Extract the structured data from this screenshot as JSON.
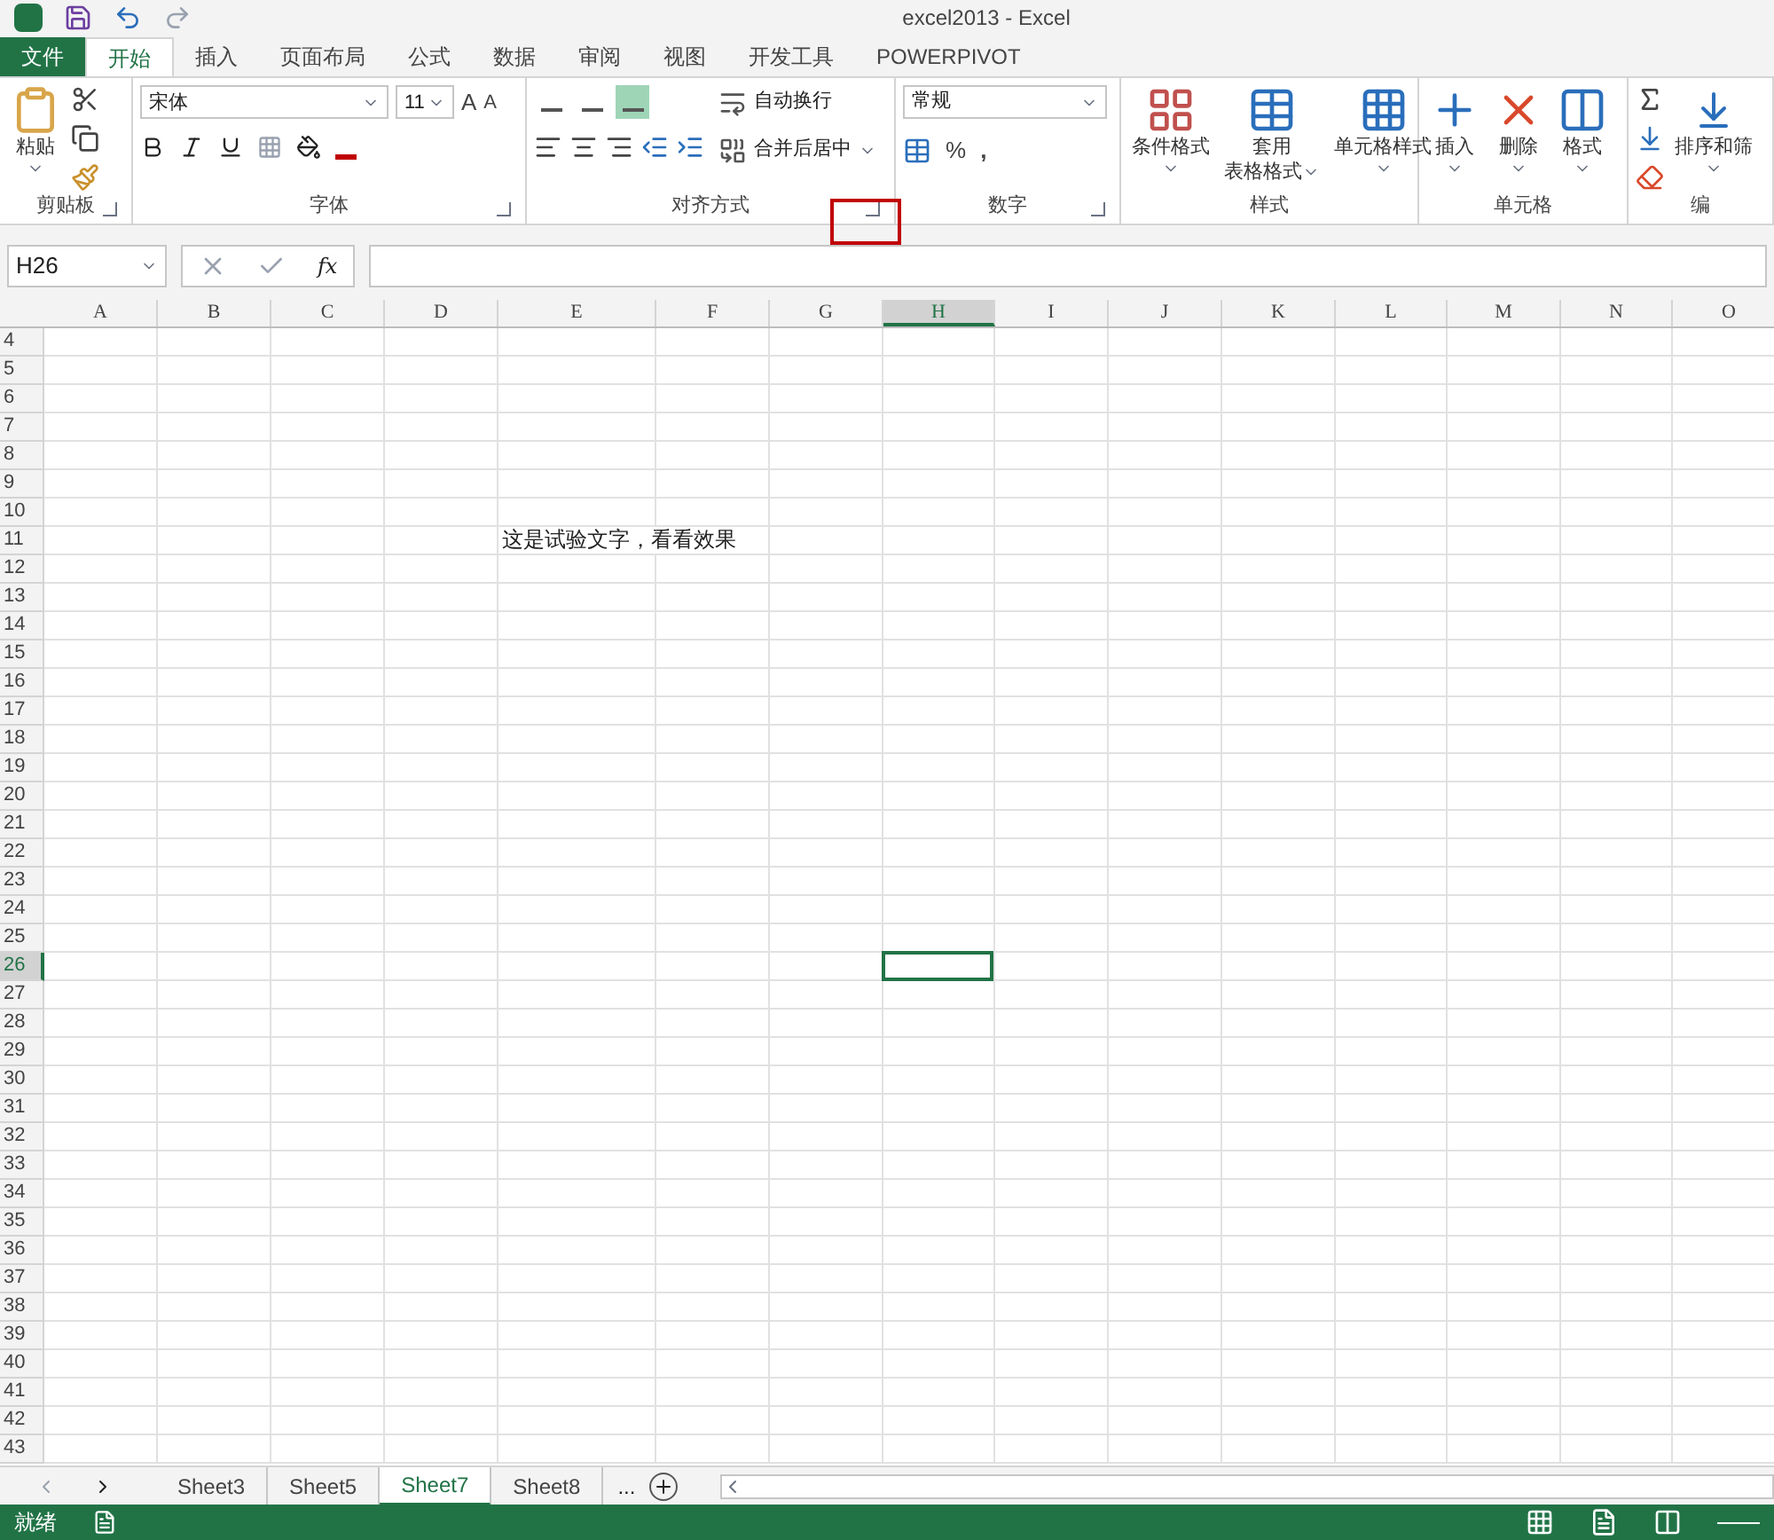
{
  "window": {
    "title": "excel2013 - Excel"
  },
  "tabs": [
    {
      "label": "文件",
      "kind": "file",
      "selected": false
    },
    {
      "label": "开始",
      "kind": "tab",
      "selected": true
    },
    {
      "label": "插入",
      "kind": "tab",
      "selected": false
    },
    {
      "label": "页面布局",
      "kind": "tab",
      "selected": false
    },
    {
      "label": "公式",
      "kind": "tab",
      "selected": false
    },
    {
      "label": "数据",
      "kind": "tab",
      "selected": false
    },
    {
      "label": "审阅",
      "kind": "tab",
      "selected": false
    },
    {
      "label": "视图",
      "kind": "tab",
      "selected": false
    },
    {
      "label": "开发工具",
      "kind": "tab",
      "selected": false
    },
    {
      "label": "POWERPIVOT",
      "kind": "tab",
      "selected": false
    }
  ],
  "ribbon": {
    "clipboard": {
      "label": "剪贴板",
      "paste": "粘贴"
    },
    "font": {
      "label": "字体",
      "font_name": "宋体",
      "font_size": "11",
      "grow_font": "A",
      "shrink_font": "A"
    },
    "alignment": {
      "label": "对齐方式",
      "wrap_text": "自动换行",
      "merge_center": "合并后居中",
      "launcher_highlighted": true,
      "vertical_align": [
        {
          "selected": false
        },
        {
          "selected": false
        },
        {
          "selected": true
        }
      ]
    },
    "number": {
      "label": "数字",
      "format": "常规",
      "percent": "%",
      "comma": ","
    },
    "styles": {
      "label": "样式",
      "conditional": "条件格式",
      "table_format": [
        "套用",
        "表格格式"
      ],
      "cell_styles": "单元格样式"
    },
    "cells": {
      "label": "单元格",
      "insert": "插入",
      "delete": "删除",
      "format": "格式"
    },
    "editing": {
      "label": "编",
      "sort_filter": "排序和筛"
    }
  },
  "formula_bar": {
    "name_box": "H26",
    "fx": "fx"
  },
  "columns": [
    {
      "label": "A",
      "selected": false
    },
    {
      "label": "B",
      "selected": false
    },
    {
      "label": "C",
      "selected": false
    },
    {
      "label": "D",
      "selected": false
    },
    {
      "label": "E",
      "selected": false
    },
    {
      "label": "F",
      "selected": false
    },
    {
      "label": "G",
      "selected": false
    },
    {
      "label": "H",
      "selected": true
    },
    {
      "label": "I",
      "selected": false
    },
    {
      "label": "J",
      "selected": false
    },
    {
      "label": "K",
      "selected": false
    },
    {
      "label": "L",
      "selected": false
    },
    {
      "label": "M",
      "selected": false
    },
    {
      "label": "N",
      "selected": false
    },
    {
      "label": "O",
      "selected": false
    }
  ],
  "rows": [
    {
      "label": "4",
      "selected": false
    },
    {
      "label": "5",
      "selected": false
    },
    {
      "label": "6",
      "selected": false
    },
    {
      "label": "7",
      "selected": false
    },
    {
      "label": "8",
      "selected": false
    },
    {
      "label": "9",
      "selected": false
    },
    {
      "label": "10",
      "selected": false
    },
    {
      "label": "11",
      "selected": false,
      "cells": [
        null,
        null,
        null,
        null,
        "这是试验文字，看看效果"
      ]
    },
    {
      "label": "12",
      "selected": false
    },
    {
      "label": "13",
      "selected": false
    },
    {
      "label": "14",
      "selected": false
    },
    {
      "label": "15",
      "selected": false
    },
    {
      "label": "16",
      "selected": false
    },
    {
      "label": "17",
      "selected": false
    },
    {
      "label": "18",
      "selected": false
    },
    {
      "label": "19",
      "selected": false
    },
    {
      "label": "20",
      "selected": false
    },
    {
      "label": "21",
      "selected": false
    },
    {
      "label": "22",
      "selected": false
    },
    {
      "label": "23",
      "selected": false
    },
    {
      "label": "24",
      "selected": false
    },
    {
      "label": "25",
      "selected": false
    },
    {
      "label": "26",
      "selected": true
    },
    {
      "label": "27",
      "selected": false
    },
    {
      "label": "28",
      "selected": false
    },
    {
      "label": "29",
      "selected": false
    },
    {
      "label": "30",
      "selected": false
    },
    {
      "label": "31",
      "selected": false
    },
    {
      "label": "32",
      "selected": false
    },
    {
      "label": "33",
      "selected": false
    },
    {
      "label": "34",
      "selected": false
    },
    {
      "label": "35",
      "selected": false
    },
    {
      "label": "36",
      "selected": false
    },
    {
      "label": "37",
      "selected": false
    },
    {
      "label": "38",
      "selected": false
    },
    {
      "label": "39",
      "selected": false
    },
    {
      "label": "40",
      "selected": false
    },
    {
      "label": "41",
      "selected": false
    },
    {
      "label": "42",
      "selected": false
    },
    {
      "label": "43",
      "selected": false
    }
  ],
  "sheet_tabs": [
    {
      "label": "Sheet3",
      "selected": false
    },
    {
      "label": "Sheet5",
      "selected": false
    },
    {
      "label": "Sheet7",
      "selected": true
    },
    {
      "label": "Sheet8",
      "selected": false
    }
  ],
  "more_sheets": "...",
  "status_bar": {
    "status": "就绪"
  }
}
